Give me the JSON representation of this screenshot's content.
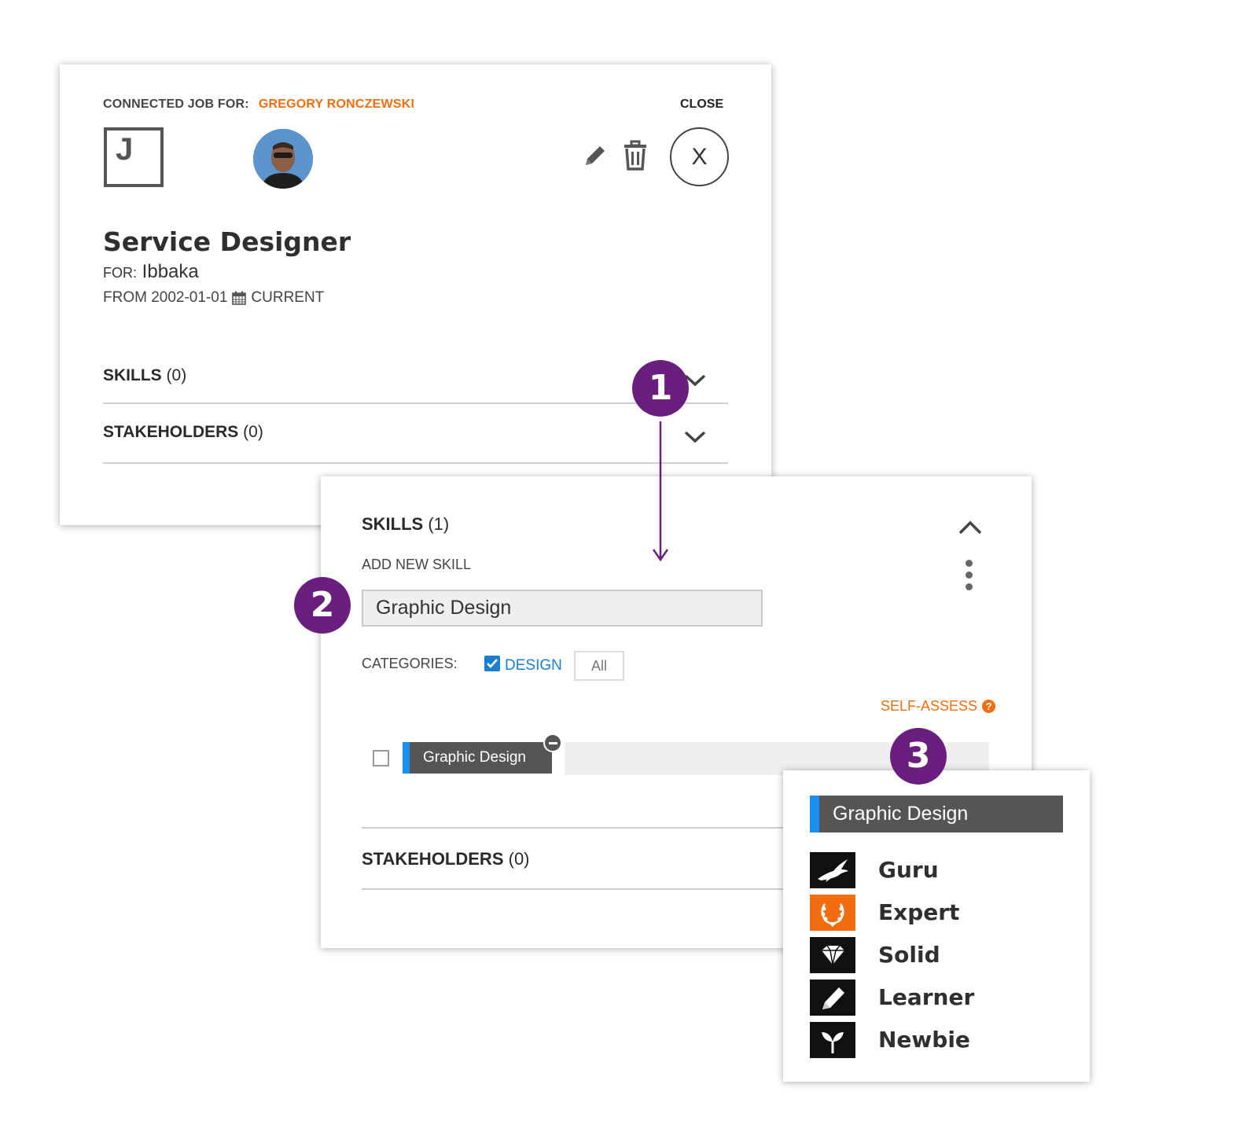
{
  "job_card": {
    "connected_label": "CONNECTED JOB FOR:",
    "person_name": "GREGORY RONCZEWSKI",
    "close_label": "CLOSE",
    "logo_letter": "J",
    "close_x": "X",
    "title": "Service Designer",
    "for_label": "FOR:",
    "company": "Ibbaka",
    "date_from": "FROM 2002-01-01",
    "date_to": "CURRENT",
    "skills_label": "SKILLS",
    "skills_count": "(0)",
    "stakeholders_label": "STAKEHOLDERS",
    "stakeholders_count": "(0)"
  },
  "skills_panel": {
    "skills_label": "SKILLS",
    "skills_count": "(1)",
    "add_label": "ADD NEW SKILL",
    "input_value": "Graphic Design",
    "categories_label": "CATEGORIES:",
    "category_design": "DESIGN",
    "category_all": "All",
    "self_assess": "SELF-ASSESS",
    "skill_tag": "Graphic Design",
    "stakeholders_label": "STAKEHOLDERS",
    "stakeholders_count": "(0)"
  },
  "assess_popup": {
    "title": "Graphic Design",
    "levels": [
      {
        "label": "Guru",
        "icon": "eagle-icon"
      },
      {
        "label": "Expert",
        "icon": "laurel-icon"
      },
      {
        "label": "Solid",
        "icon": "diamond-icon"
      },
      {
        "label": "Learner",
        "icon": "pencil-icon"
      },
      {
        "label": "Newbie",
        "icon": "sprout-icon"
      }
    ]
  },
  "steps": [
    "1",
    "2",
    "3"
  ],
  "colors": {
    "accent_orange": "#f26d0f",
    "link_blue": "#1b7fd1",
    "tag_blue": "#1b8ff0",
    "step_purple": "#6a1f7f",
    "tag_gray": "#555555"
  }
}
